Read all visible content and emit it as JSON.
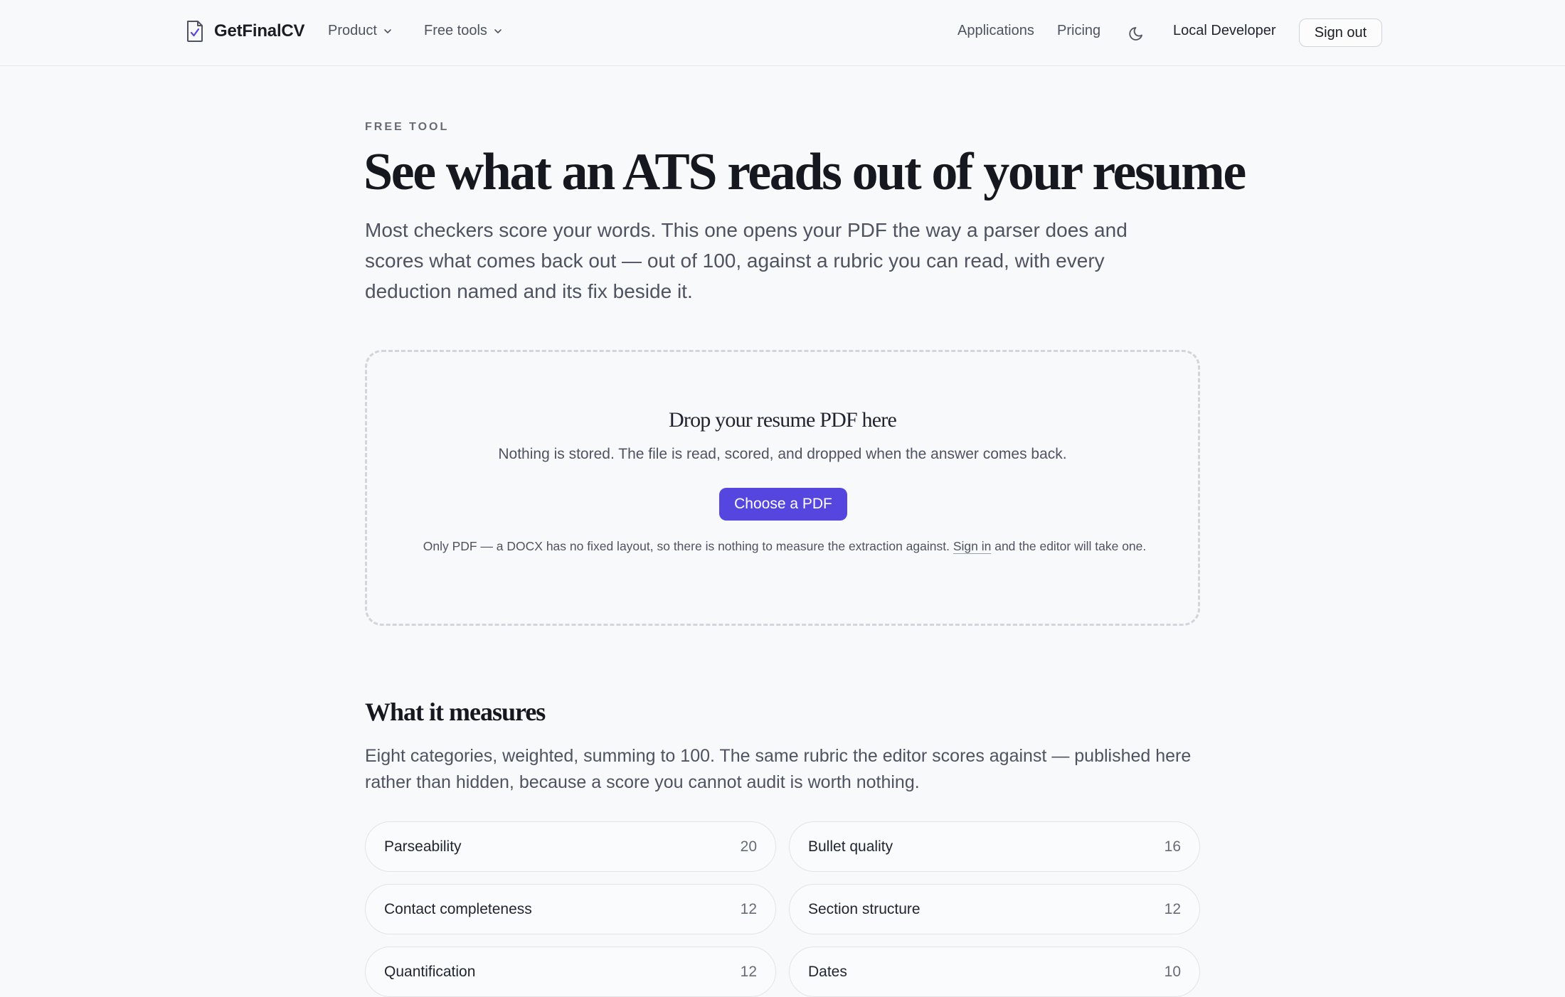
{
  "header": {
    "brand": "GetFinalCV",
    "nav": [
      {
        "label": "Product"
      },
      {
        "label": "Free tools"
      }
    ],
    "links": [
      "Applications",
      "Pricing"
    ],
    "user": "Local Developer",
    "signout_label": "Sign out"
  },
  "hero": {
    "eyebrow": "FREE TOOL",
    "title": "See what an ATS reads out of your resume",
    "subtitle": "Most checkers score your words. This one opens your PDF the way a parser does and scores what comes back out — out of 100, against a rubric you can read, with every deduction named and its fix beside it."
  },
  "dropzone": {
    "title": "Drop your resume PDF here",
    "subtitle": "Nothing is stored. The file is read, scored, and dropped when the answer comes back.",
    "button": "Choose a PDF",
    "note_before": "Only PDF — a DOCX has no fixed layout, so there is nothing to measure the extraction against. ",
    "note_link": "Sign in",
    "note_after": " and the editor will take one."
  },
  "measures": {
    "title": "What it measures",
    "subtitle": "Eight categories, weighted, summing to 100. The same rubric the editor scores against — published here rather than hidden, because a score you cannot audit is worth nothing.",
    "categories": [
      {
        "name": "Parseability",
        "points": "20"
      },
      {
        "name": "Bullet quality",
        "points": "16"
      },
      {
        "name": "Contact completeness",
        "points": "12"
      },
      {
        "name": "Section structure",
        "points": "12"
      },
      {
        "name": "Quantification",
        "points": "12"
      },
      {
        "name": "Dates",
        "points": "10"
      }
    ]
  },
  "colors": {
    "accent": "#5546e0",
    "background": "#f8f9fb"
  }
}
